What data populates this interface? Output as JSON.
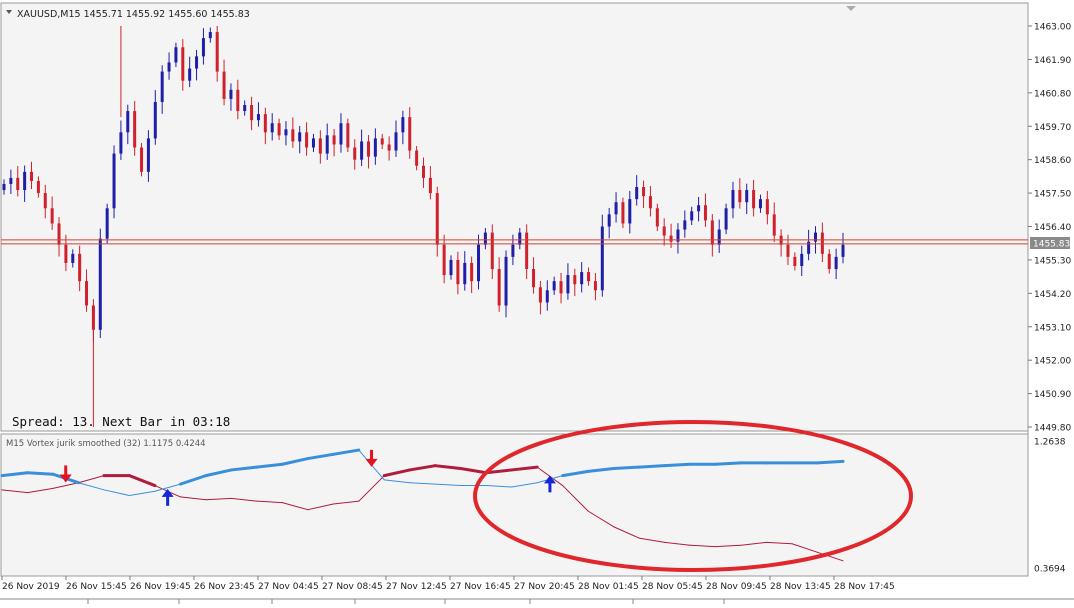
{
  "header": {
    "symbol_info": "XAUUSD,M15  1455.71 1455.92 1455.60 1455.83",
    "current_price_label": "1455.83",
    "spread_text": "Spread: 13. Next Bar in 03:18"
  },
  "indicator": {
    "label": "M15 Vortex jurik smoothed (32) 1.1175 0.4244"
  },
  "colors": {
    "bull": "#1e1ea8",
    "bear": "#d0202c",
    "vi_plus": "#3a8fdb",
    "vi_minus": "#b01c3c",
    "highlight_ellipse": "#e0282c",
    "grid": "#c8c8c8",
    "hline": "#d04030"
  },
  "chart_data": [
    {
      "type": "candlestick",
      "ylim": [
        1449.8,
        1463.5
      ],
      "y_ticks": [
        "1463.00",
        "1461.90",
        "1460.80",
        "1459.70",
        "1458.60",
        "1457.50",
        "1456.40",
        "1455.30",
        "1454.20",
        "1453.10",
        "1452.00",
        "1450.90",
        "1449.80"
      ],
      "x_ticks": [
        "26 Nov 2019",
        "26 Nov 15:45",
        "26 Nov 19:45",
        "26 Nov 23:45",
        "27 Nov 04:45",
        "27 Nov 08:45",
        "27 Nov 12:45",
        "27 Nov 16:45",
        "27 Nov 20:45",
        "28 Nov 01:45",
        "28 Nov 05:45",
        "28 Nov 09:45",
        "28 Nov 13:45",
        "28 Nov 17:45"
      ],
      "horizontal_lines": [
        1455.96,
        1455.83
      ],
      "close_path": [
        1457.8,
        1458.0,
        1457.6,
        1458.2,
        1457.9,
        1457.5,
        1457.0,
        1456.5,
        1455.8,
        1455.2,
        1455.5,
        1454.6,
        1453.8,
        1453.0,
        1456.0,
        1457.0,
        1458.8,
        1459.5,
        1460.2,
        1459.0,
        1458.2,
        1459.3,
        1460.5,
        1461.5,
        1461.8,
        1462.3,
        1461.2,
        1461.6,
        1462.0,
        1462.6,
        1462.8,
        1461.5,
        1460.6,
        1460.9,
        1460.2,
        1460.4,
        1459.9,
        1460.1,
        1459.5,
        1459.8,
        1459.4,
        1459.6,
        1459.2,
        1459.5,
        1459.0,
        1459.3,
        1458.8,
        1459.4,
        1459.1,
        1459.8,
        1459.0,
        1458.6,
        1459.2,
        1458.7,
        1459.3,
        1459.1,
        1458.9,
        1459.5,
        1460.0,
        1458.9,
        1458.4,
        1458.0,
        1457.5,
        1455.8,
        1454.8,
        1455.3,
        1454.5,
        1455.2,
        1454.6,
        1455.8,
        1456.2,
        1455.0,
        1453.8,
        1455.4,
        1455.8,
        1456.2,
        1455.0,
        1454.4,
        1453.9,
        1454.3,
        1454.6,
        1454.2,
        1454.8,
        1454.5,
        1454.9,
        1454.6,
        1454.3,
        1456.4,
        1456.8,
        1457.2,
        1456.5,
        1457.3,
        1457.7,
        1457.4,
        1457.0,
        1456.4,
        1456.1,
        1455.9,
        1456.3,
        1456.6,
        1456.9,
        1457.1,
        1456.6,
        1455.8,
        1456.3,
        1457.0,
        1457.6,
        1457.2,
        1457.6,
        1457.0,
        1457.3,
        1456.8,
        1456.1,
        1455.8,
        1455.4,
        1455.1,
        1455.5,
        1455.9,
        1456.2,
        1455.5,
        1455.0,
        1455.4,
        1455.8
      ],
      "high": 1463.0,
      "low": 1449.8
    },
    {
      "type": "line",
      "name": "Vortex jurik smoothed",
      "ylim": [
        0.3694,
        1.2638
      ],
      "y_ticks": [
        "1.2638",
        "0.3694"
      ],
      "series": [
        {
          "name": "VI+",
          "color": "#3a8fdb",
          "values": [
            1.02,
            1.04,
            1.03,
            0.97,
            0.92,
            0.88,
            0.91,
            0.96,
            1.02,
            1.06,
            1.08,
            1.1,
            1.14,
            1.17,
            1.2,
            0.99,
            0.97,
            0.96,
            0.95,
            0.95,
            0.94,
            0.97,
            1.02,
            1.05,
            1.07,
            1.08,
            1.09,
            1.1,
            1.1,
            1.11,
            1.11,
            1.11,
            1.11,
            1.12
          ]
        },
        {
          "name": "VI-",
          "color": "#b01c3c",
          "values": [
            0.92,
            0.9,
            0.93,
            0.97,
            1.02,
            1.02,
            0.95,
            0.87,
            0.85,
            0.86,
            0.84,
            0.83,
            0.78,
            0.82,
            0.84,
            1.02,
            1.06,
            1.09,
            1.07,
            1.04,
            1.06,
            1.08,
            0.95,
            0.77,
            0.66,
            0.58,
            0.55,
            0.53,
            0.52,
            0.53,
            0.55,
            0.54,
            0.48,
            0.42
          ]
        }
      ]
    }
  ]
}
